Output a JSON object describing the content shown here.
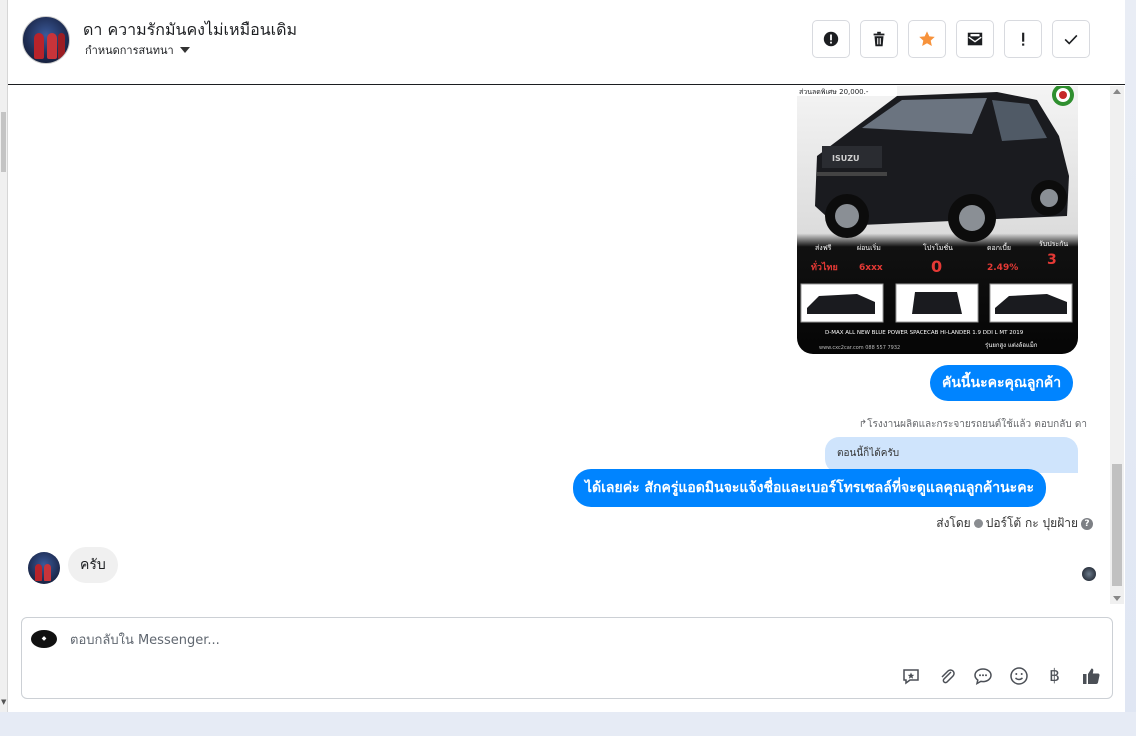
{
  "header": {
    "contact_name": "ดา ความรักมันคงไม่เหมือนเดิม",
    "status_label": "กำหนดการสนทนา"
  },
  "toolbar": {
    "buttons": [
      {
        "name": "spam-button",
        "icon": "alert-circle-icon"
      },
      {
        "name": "delete-button",
        "icon": "trash-icon"
      },
      {
        "name": "star-button",
        "icon": "star-icon",
        "color": "#f7923b"
      },
      {
        "name": "mark-unread-button",
        "icon": "mail-icon"
      },
      {
        "name": "important-button",
        "icon": "exclamation-icon"
      },
      {
        "name": "done-button",
        "icon": "check-icon"
      }
    ]
  },
  "image_message": {
    "banner": "ส่วนลดพิเศษ 20,000.-",
    "brand": "ISUZU",
    "promos": [
      {
        "label": "ส่งฟรี",
        "value": "ทั่วไทย"
      },
      {
        "label": "ผ่อนเริ่ม",
        "value": "6xxx"
      },
      {
        "label": "โปรโมชั่น",
        "value": "0"
      },
      {
        "label": "ดอกเบี้ย",
        "value": "2.49%"
      },
      {
        "label": "รับประกัน",
        "value": "3"
      }
    ],
    "model_line": "D-MAX ALL NEW BLUE POWER SPACECAB HI-LANDER 1.9 DDI L MT 2019",
    "contact_line": "www.cxc2car.com  088 557 7932",
    "tagline": "รุ่นยกสูง แต่งล้อแม็ก"
  },
  "messages": {
    "out1": "คันนี้นะคะคุณลูกค้า",
    "reply_meta": "โรงงานผลิตและกระจายรถยนต์ใช้แล้ว ตอบกลับ ดา",
    "reply_quote": "ตอนนี้ก็ได้ครับ",
    "out2": "ได้เลยค่ะ สักครู่แอดมินจะแจ้งชื่อและเบอร์โทรเซลล์ที่จะดูแลคุณลูกค้านะคะ",
    "sent_by_prefix": "ส่งโดย",
    "sent_by_name": "ปอร์โต้ กะ ปุยฝ้าย",
    "in1": "ครับ"
  },
  "composer": {
    "placeholder": "ตอบกลับใน Messenger...",
    "tools": [
      "saved-reply-icon",
      "attachment-icon",
      "chat-bubble-icon",
      "emoji-icon",
      "baht-icon",
      "thumbs-up-icon"
    ],
    "baht_symbol": "฿"
  },
  "colors": {
    "accent": "#0084ff",
    "reply_bubble": "#cfe4fc",
    "incoming_bubble": "#f0f0f0",
    "star": "#f7923b"
  }
}
